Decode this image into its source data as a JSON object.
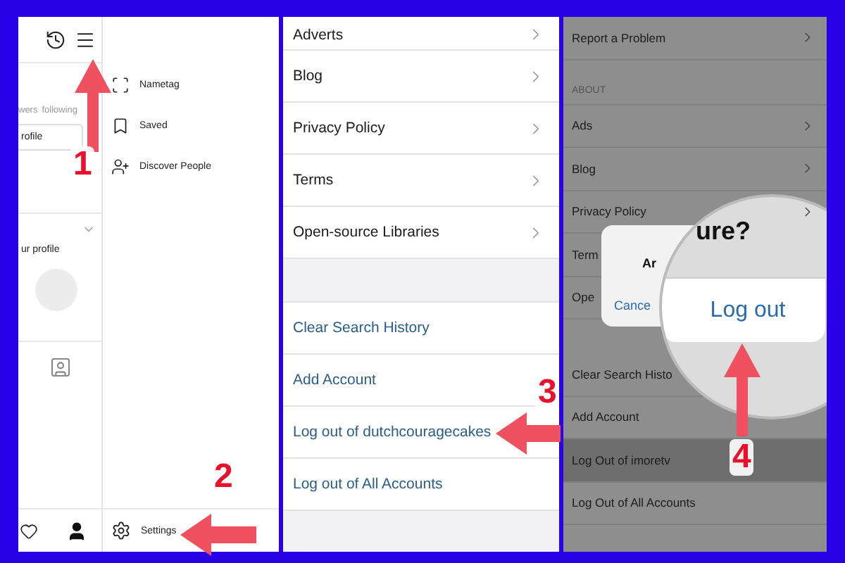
{
  "profile_screen": {
    "stats_left": "wers",
    "stats_right": "following",
    "button": "rofile",
    "section": "ur profile"
  },
  "menu_drawer": {
    "items": [
      {
        "label": "Nametag",
        "kind": "nametag"
      },
      {
        "label": "Saved",
        "kind": "saved"
      },
      {
        "label": "Discover People",
        "kind": "discover"
      }
    ],
    "settings": "Settings"
  },
  "settings_list": {
    "items": [
      {
        "label": "Adverts",
        "kind": "link"
      },
      {
        "label": "Blog",
        "kind": "link"
      },
      {
        "label": "Privacy Policy",
        "kind": "link"
      },
      {
        "label": "Terms",
        "kind": "link"
      },
      {
        "label": "Open-source Libraries",
        "kind": "link"
      },
      {
        "kind": "gap"
      },
      {
        "label": "Clear Search History",
        "kind": "action"
      },
      {
        "label": "Add Account",
        "kind": "action"
      },
      {
        "label": "Log out of dutchcouragecakes",
        "kind": "action"
      },
      {
        "label": "Log out of All Accounts",
        "kind": "action"
      }
    ]
  },
  "dimmed_settings": {
    "items": [
      {
        "label": "Report a Problem",
        "kind": "link",
        "highlighted": false
      },
      {
        "label": "ABOUT",
        "kind": "header"
      },
      {
        "label": "Ads",
        "kind": "link",
        "highlighted": false
      },
      {
        "label": "Blog",
        "kind": "link",
        "highlighted": false
      },
      {
        "label": "Privacy Policy",
        "kind": "link",
        "highlighted": false
      },
      {
        "label": "Term",
        "kind": "plain",
        "highlighted": false
      },
      {
        "label": "Ope",
        "kind": "plain",
        "highlighted": false
      },
      {
        "kind": "gap"
      },
      {
        "label": "Clear Search Histo",
        "kind": "plain",
        "highlighted": false
      },
      {
        "label": "Add Account",
        "kind": "plain",
        "highlighted": false
      },
      {
        "label": "Log Out of imoretv",
        "kind": "plain",
        "highlighted": true
      },
      {
        "label": "Log Out of All Accounts",
        "kind": "plain",
        "highlighted": false
      }
    ],
    "dialog": {
      "message": "Ar",
      "cancel": "Cance"
    },
    "magnifier": {
      "title": "ure?",
      "button": "Log out"
    }
  },
  "steps": [
    {
      "number": "1",
      "kind": "up"
    },
    {
      "number": "2",
      "kind": "left"
    },
    {
      "number": "3",
      "kind": "left"
    },
    {
      "number": "4",
      "kind": "up"
    }
  ]
}
